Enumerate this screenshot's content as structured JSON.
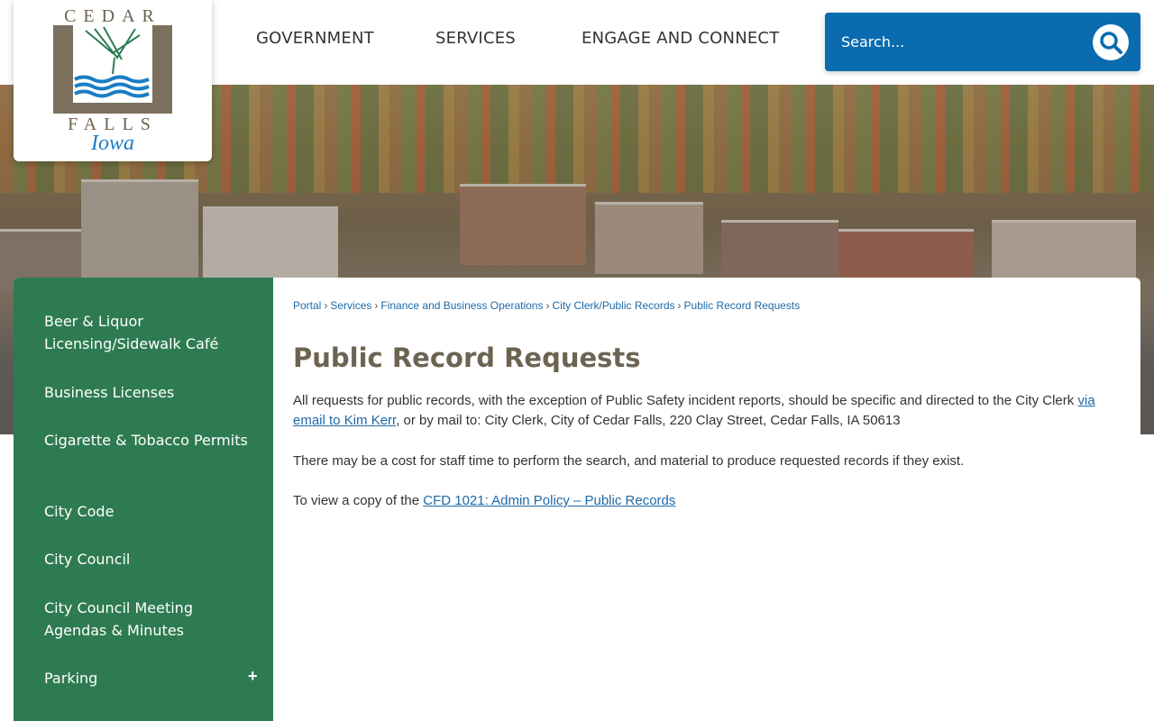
{
  "logo": {
    "top_text": "CEDAR",
    "bottom_text": "FALLS",
    "script_text": "Iowa"
  },
  "nav": {
    "items": [
      "GOVERNMENT",
      "SERVICES",
      "ENGAGE AND CONNECT"
    ]
  },
  "search": {
    "placeholder": "Search..."
  },
  "sidebar": {
    "items": [
      "Beer & Liquor Licensing/Sidewalk Café",
      "Business Licenses",
      "Cigarette & Tobacco Permits",
      "City Code",
      "City Council",
      "City Council Meeting Agendas & Minutes",
      "Parking"
    ],
    "expand_symbol": "+"
  },
  "breadcrumb": [
    "Portal",
    "Services",
    "Finance and Business Operations",
    "City Clerk/Public Records",
    "Public Record Requests"
  ],
  "breadcrumb_sep": "›",
  "page_title": "Public Record Requests",
  "paragraphs": {
    "p1_before": "All requests for public records, with the exception of Public Safety incident reports, should be specific and directed to the City Clerk ",
    "p1_link": "via email to Kim Kerr",
    "p1_after": ", or by mail to: City Clerk, City of Cedar Falls, 220 Clay Street, Cedar Falls, IA 50613",
    "p2": "There may be a cost for staff time to perform the search, and material to produce requested records if they exist.",
    "p3_before": "To view a copy of the ",
    "p3_link": "CFD 1021: Admin Policy – Public Records"
  },
  "colors": {
    "sidebar_green": "#2e7b51",
    "search_blue": "#0a6bae",
    "link_blue": "#1e6aa8",
    "title_brown": "#6d6351"
  }
}
